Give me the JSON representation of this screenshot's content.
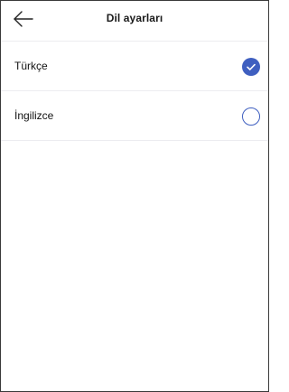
{
  "header": {
    "title": "Dil ayarları",
    "back_icon": "arrow-left-icon"
  },
  "languages": [
    {
      "label": "Türkçe",
      "selected": true
    },
    {
      "label": "İngilizce",
      "selected": false
    }
  ],
  "colors": {
    "accent": "#3f5fc0",
    "divider": "#ececf0",
    "frame": "#3a3a3a"
  }
}
